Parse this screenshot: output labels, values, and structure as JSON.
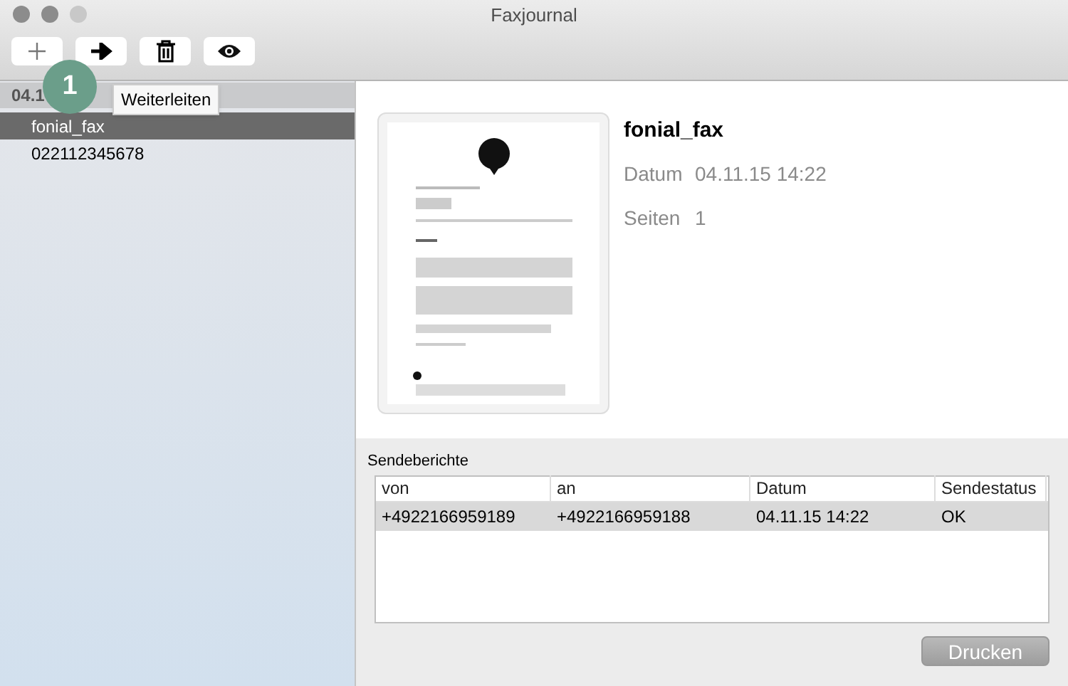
{
  "window": {
    "title": "Faxjournal"
  },
  "toolbar": {
    "buttons": [
      {
        "kind": "add"
      },
      {
        "kind": "forward"
      },
      {
        "kind": "delete"
      },
      {
        "kind": "preview"
      }
    ],
    "tooltip": "Weiterleiten",
    "badge": "1"
  },
  "sidebar": {
    "group": "04.1",
    "items": [
      {
        "label": "fonial_fax",
        "selected": true
      },
      {
        "label": "022112345678",
        "selected": false
      }
    ]
  },
  "detail": {
    "title": "fonial_fax",
    "fields": [
      {
        "label": "Datum",
        "value": "04.11.15 14:22"
      },
      {
        "label": "Seiten",
        "value": "1"
      }
    ]
  },
  "reports": {
    "title": "Sendeberichte",
    "columns": [
      "von",
      "an",
      "Datum",
      "Sendestatus"
    ],
    "rows": [
      {
        "cells": [
          "+4922166959189",
          "+4922166959188",
          "04.11.15 14:22",
          "OK"
        ],
        "selected": true
      }
    ]
  },
  "print_button": "Drucken"
}
